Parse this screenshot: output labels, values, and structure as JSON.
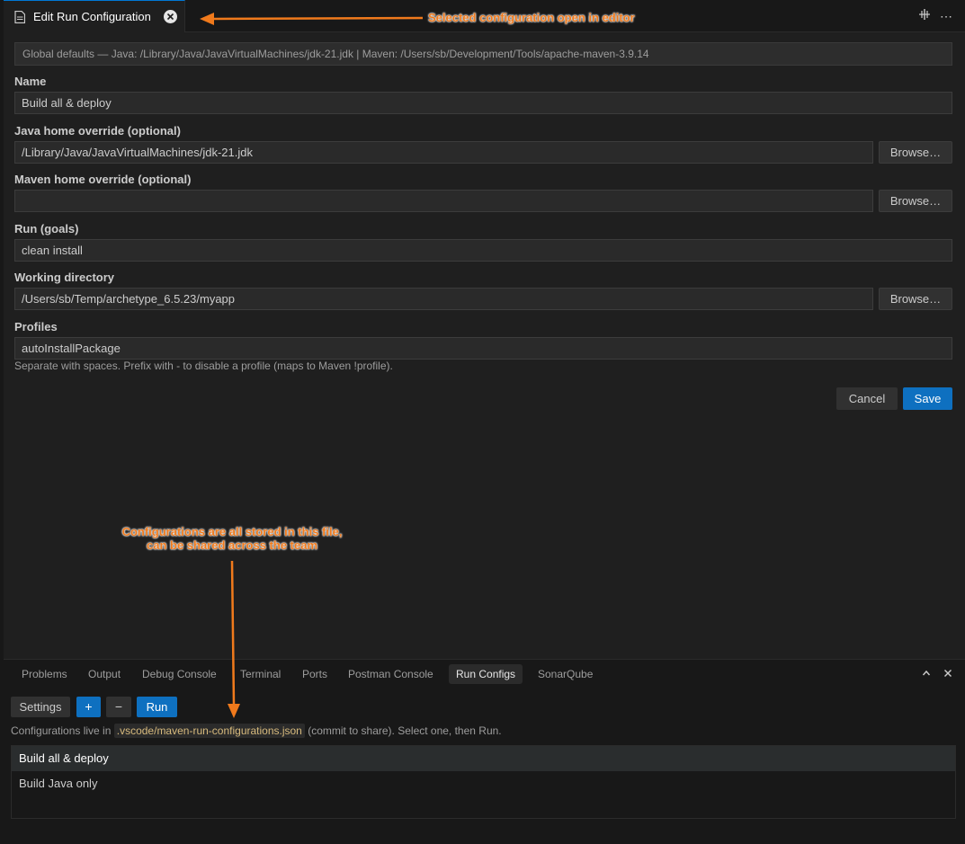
{
  "tab": {
    "title": "Edit Run Configuration"
  },
  "tab_actions": {
    "split_icon": "split-editor-icon",
    "more_icon": "more-actions-icon"
  },
  "global_defaults": "Global defaults — Java: /Library/Java/JavaVirtualMachines/jdk-21.jdk | Maven: /Users/sb/Development/Tools/apache-maven-3.9.14",
  "form": {
    "name_label": "Name",
    "name_value": "Build all & deploy",
    "java_home_label": "Java home override (optional)",
    "java_home_value": "/Library/Java/JavaVirtualMachines/jdk-21.jdk",
    "maven_home_label": "Maven home override (optional)",
    "maven_home_value": "",
    "goals_label": "Run (goals)",
    "goals_value": "clean install",
    "workdir_label": "Working directory",
    "workdir_value": "/Users/sb/Temp/archetype_6.5.23/myapp",
    "profiles_label": "Profiles",
    "profiles_value": "autoInstallPackage",
    "profiles_hint": "Separate with spaces. Prefix with - to disable a profile (maps to Maven !profile).",
    "browse_label": "Browse…",
    "cancel_label": "Cancel",
    "save_label": "Save"
  },
  "panel": {
    "tabs": [
      "Problems",
      "Output",
      "Debug Console",
      "Terminal",
      "Ports",
      "Postman Console",
      "Run Configs",
      "SonarQube"
    ],
    "active_tab": "Run Configs",
    "settings_label": "Settings",
    "add_label": "+",
    "remove_label": "−",
    "run_label": "Run",
    "info_prefix": "Configurations live in",
    "info_file": ".vscode/maven-run-configurations.json",
    "info_suffix": "(commit to share). Select one, then Run.",
    "configs": [
      "Build all & deploy",
      "Build Java only"
    ],
    "selected_config": "Build all & deploy"
  },
  "annotations": {
    "editor_note": "Selected configuration open in editor",
    "file_note_line1": "Configurations are all stored in this file,",
    "file_note_line2": "can be shared across the team"
  },
  "colors": {
    "accent": "#0e70c0",
    "annotation": "#f07a1c",
    "background": "#1f1f1f"
  }
}
